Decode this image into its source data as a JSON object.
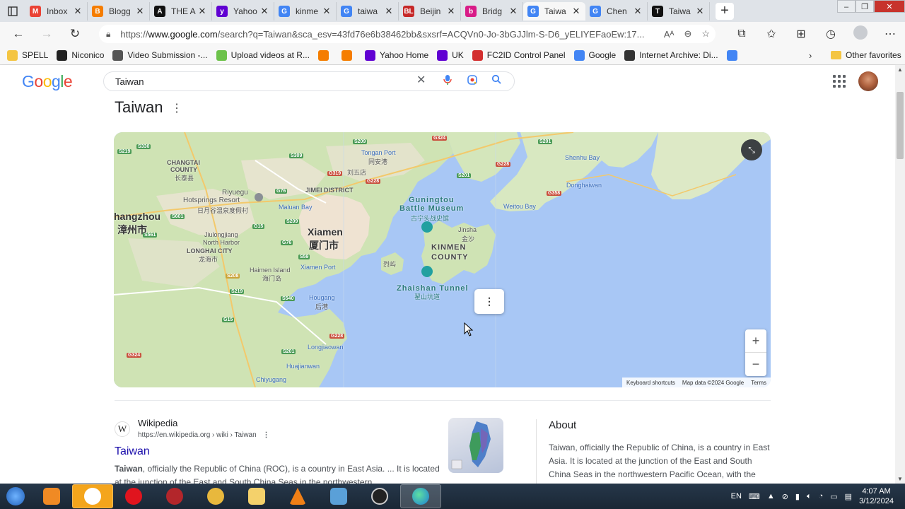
{
  "tabs": [
    {
      "label": "Inbox",
      "fav": "M",
      "color": "#ea4335"
    },
    {
      "label": "Blogg",
      "fav": "B",
      "color": "#f57d00"
    },
    {
      "label": "THE A",
      "fav": "A",
      "color": "#111111"
    },
    {
      "label": "Yahoo",
      "fav": "y",
      "color": "#6001d2"
    },
    {
      "label": "kinme",
      "fav": "G",
      "color": "#4285f4"
    },
    {
      "label": "taiwa",
      "fav": "G",
      "color": "#4285f4"
    },
    {
      "label": "Beijin",
      "fav": "BL",
      "color": "#c62828"
    },
    {
      "label": "Bridg",
      "fav": "b",
      "color": "#d81b87"
    },
    {
      "label": "Taiwa",
      "fav": "G",
      "color": "#4285f4"
    },
    {
      "label": "Chen",
      "fav": "G",
      "color": "#4285f4"
    },
    {
      "label": "Taiwa",
      "fav": "T",
      "color": "#111111"
    }
  ],
  "address": {
    "prefix": "https://",
    "host": "www.google.com",
    "path": "/search?q=Taiwan&sca_esv=43fd76e6b38462bb&sxsrf=ACQVn0-Jo-3bGJJlm-S-D6_yELIYEFaoEw:17..."
  },
  "favorites": [
    {
      "label": "SPELL",
      "color": "#f4c542",
      "icon": "folder"
    },
    {
      "label": "Niconico",
      "color": "#222222",
      "icon": "tv"
    },
    {
      "label": "Video Submission -...",
      "color": "#555555",
      "icon": "clapper"
    },
    {
      "label": "Upload videos at R...",
      "color": "#6cc24a",
      "icon": "play"
    },
    {
      "label": "",
      "color": "#f57d00",
      "icon": "B"
    },
    {
      "label": "",
      "color": "#f57d00",
      "icon": "B"
    },
    {
      "label": "Yahoo Home",
      "color": "#6001d2",
      "icon": "y"
    },
    {
      "label": "UK",
      "color": "#6001d2",
      "icon": "y"
    },
    {
      "label": "FC2ID Control Panel",
      "color": "#d32f2f",
      "icon": "fc2"
    },
    {
      "label": "Google",
      "color": "#4285f4",
      "icon": "G"
    },
    {
      "label": "Internet Archive: Di...",
      "color": "#333333",
      "icon": "ia"
    },
    {
      "label": "",
      "color": "#4285f4",
      "icon": "translate"
    }
  ],
  "other_favorites": "Other favorites",
  "google": {
    "logo": [
      "G",
      "o",
      "o",
      "g",
      "l",
      "e"
    ],
    "logo_colors": [
      "#4285f4",
      "#ea4335",
      "#fbbc05",
      "#4285f4",
      "#34a853",
      "#ea4335"
    ],
    "query": "Taiwan"
  },
  "kp": {
    "title": "Taiwan"
  },
  "map": {
    "labels": {
      "changtai": "CHANGTAI",
      "county": "COUNTY",
      "changtai_cn": "长泰县",
      "riyuegu": "Riyuegu",
      "hotsprings": "Hotsprings Resort",
      "hotsprings_cn": "日月谷温泉度假村",
      "jimei": "JIMEI DISTRICT",
      "maluan": "Maluan Bay",
      "tongan": "Tongan Port",
      "tongan_cn": "同安港",
      "zhangzhou": "hangzhou",
      "zhangzhou_cn": "漳州市",
      "jiulongjiang": "Jiulongjiang",
      "north_harbor": "North Harbor",
      "longhai": "LONGHAI CITY",
      "longhai_cn": "龙海市",
      "xiamen": "Xiamen",
      "xiamen_cn": "厦门市",
      "xiamen_port": "Xiamen Port",
      "haimen": "Haimen Island",
      "haimen_cn": "海门岛",
      "houguang": "Hougang",
      "houguang_cn": "后港",
      "longjiaowan": "Longjiaowan",
      "huajianwan": "Huajianwan",
      "chiyugang": "Chiyugang",
      "gunington": "Guningtou",
      "battle_museum": "Battle Museum",
      "museum_cn": "古宁头战史馆",
      "jinsha": "Jinsha",
      "jinsha_cn": "金沙",
      "kinmen": "KINMEN",
      "kinmen_county": "COUNTY",
      "lieyu": "烈屿",
      "zhaishan": "Zhaishan Tunnel",
      "zhaishan_cn": "翟山坑道",
      "shenhu": "Shenhu Bay",
      "donghai": "Donghaiwan",
      "weitou": "Weitou Bay",
      "liuwudian": "刘五店"
    },
    "roads": [
      "G324",
      "S209",
      "S201",
      "G228",
      "S330",
      "S219",
      "S309",
      "G319",
      "G76",
      "S601",
      "G228",
      "G15",
      "S561",
      "S208",
      "S219",
      "S209",
      "G76",
      "S59",
      "S540",
      "G15",
      "S201",
      "G324",
      "G228",
      "S201",
      "G358"
    ],
    "zoom_in": "+",
    "zoom_out": "−",
    "attribution": [
      "Keyboard shortcuts",
      "Map data ©2024 Google",
      "Terms"
    ]
  },
  "result": {
    "source": "Wikipedia",
    "cite": "https://en.wikipedia.org › wiki › Taiwan",
    "title": "Taiwan",
    "bold": "Taiwan",
    "snippet": ", officially the Republic of China (ROC), is a country in East Asia. ... It is located at the junction of the East and South China Seas in the northwestern ..."
  },
  "about": {
    "heading": "About",
    "text": "Taiwan, officially the Republic of China, is a country in East Asia. It is located at the junction of the East and South China Seas in the northwestern Pacific Ocean, with the"
  },
  "taskbar": {
    "lang": "EN",
    "time": "4:07 AM",
    "date": "3/12/2024"
  }
}
